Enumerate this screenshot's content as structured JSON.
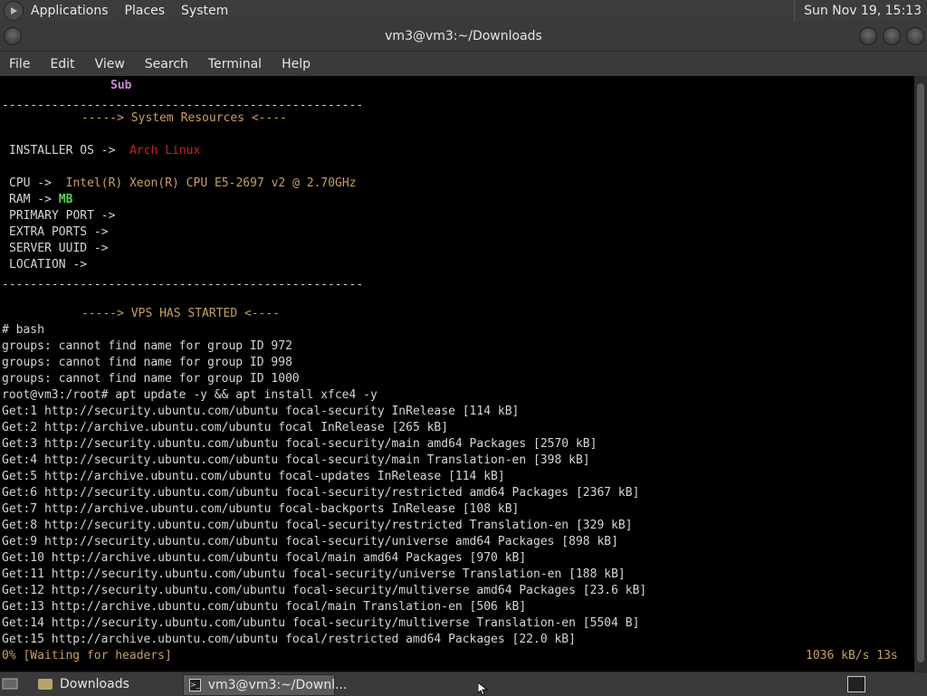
{
  "topbar": {
    "menus": [
      "Applications",
      "Places",
      "System"
    ],
    "clock": "Sun Nov 19, 15:13"
  },
  "window": {
    "title": "vm3@vm3:~/Downloads"
  },
  "menubar": [
    "File",
    "Edit",
    "View",
    "Search",
    "Terminal",
    "Help"
  ],
  "colors": {
    "sub": "#c88cd8",
    "section": "#c8a05a",
    "arch": "#d02020",
    "cpu": "#c8a05a",
    "mb": "#5fd05f",
    "status": "#c8a05a"
  },
  "terminal": {
    "sub_label": "Sub",
    "separator": "---------------------------------------------------",
    "system_resources": "-----> System Resources <----",
    "installer_os_label": "INSTALLER OS ->",
    "installer_os_value": "Arch Linux",
    "cpu_label": "CPU ->",
    "cpu_value": "Intel(R) Xeon(R) CPU E5-2697 v2 @ 2.70GHz",
    "ram_label": "RAM ->",
    "ram_value": "MB",
    "primary_port": "PRIMARY PORT ->",
    "extra_ports": "EXTRA PORTS ->",
    "server_uuid": "SERVER UUID ->",
    "location": "LOCATION ->",
    "vps_started": "-----> VPS HAS STARTED <----",
    "lines": [
      "# bash",
      "groups: cannot find name for group ID 972",
      "groups: cannot find name for group ID 998",
      "groups: cannot find name for group ID 1000",
      "root@vm3:/root# apt update -y && apt install xfce4 -y",
      "Get:1 http://security.ubuntu.com/ubuntu focal-security InRelease [114 kB]",
      "Get:2 http://archive.ubuntu.com/ubuntu focal InRelease [265 kB]",
      "Get:3 http://security.ubuntu.com/ubuntu focal-security/main amd64 Packages [2570 kB]",
      "Get:4 http://security.ubuntu.com/ubuntu focal-security/main Translation-en [398 kB]",
      "Get:5 http://archive.ubuntu.com/ubuntu focal-updates InRelease [114 kB]",
      "Get:6 http://security.ubuntu.com/ubuntu focal-security/restricted amd64 Packages [2367 kB]",
      "Get:7 http://archive.ubuntu.com/ubuntu focal-backports InRelease [108 kB]",
      "Get:8 http://security.ubuntu.com/ubuntu focal-security/restricted Translation-en [329 kB]",
      "Get:9 http://security.ubuntu.com/ubuntu focal-security/universe amd64 Packages [898 kB]",
      "Get:10 http://archive.ubuntu.com/ubuntu focal/main amd64 Packages [970 kB]",
      "Get:11 http://security.ubuntu.com/ubuntu focal-security/universe Translation-en [188 kB]",
      "Get:12 http://security.ubuntu.com/ubuntu focal-security/multiverse amd64 Packages [23.6 kB]",
      "Get:13 http://archive.ubuntu.com/ubuntu focal/main Translation-en [506 kB]",
      "Get:14 http://security.ubuntu.com/ubuntu focal-security/multiverse Translation-en [5504 B]",
      "Get:15 http://archive.ubuntu.com/ubuntu focal/restricted amd64 Packages [22.0 kB]"
    ],
    "status_left": "0% [Waiting for headers]",
    "status_right": "1036 kB/s 13s"
  },
  "taskbar": {
    "downloads": "Downloads",
    "terminal_task": "vm3@vm3:~/Downl..."
  }
}
